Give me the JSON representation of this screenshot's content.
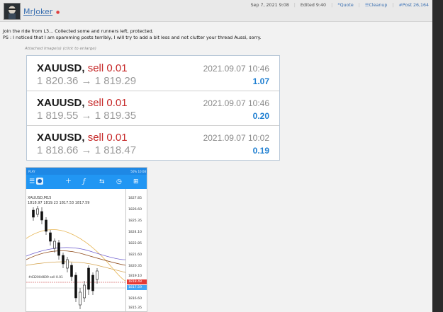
{
  "post": {
    "username": "MrJoker",
    "date": "Sep 7, 2021 9:08",
    "edited": "Edited 9:40",
    "quote_label": "Quote",
    "cleanup_label": "Cleanup",
    "post_number": "Post 26,164",
    "line1": "Join the ride from L3... Collected some and runners left, protected.",
    "line2": "PS : I noticed that I am spamming posts terribly, I will try to add a bit less and not clutter your thread Aussi, sorry.",
    "attach_caption": "Attached Image(s) (click to enlarge)"
  },
  "trades": [
    {
      "symbol": "XAUUSD,",
      "action": "sell 0.01",
      "prices": "1 820.36 → 1 819.29",
      "date": "2021.09.07 10:46",
      "profit": "1.07"
    },
    {
      "symbol": "XAUUSD,",
      "action": "sell 0.01",
      "prices": "1 819.55 → 1 819.35",
      "date": "2021.09.07 10:46",
      "profit": "0.20"
    },
    {
      "symbol": "XAUUSD,",
      "action": "sell 0.01",
      "prices": "1 818.66 → 1 818.47",
      "date": "2021.09.07 10:02",
      "profit": "0.19"
    }
  ],
  "phone": {
    "status_left": "PLAY",
    "status_right": "50% 10:08",
    "symbol_timeframe": "XAUUSD,M15",
    "ohlc": "1818.97 1819.23 1817.53 1817.59",
    "ticket": "#432004609 sell 0.01",
    "price_ticks": [
      "1827.85",
      "1826.60",
      "1825.35",
      "1824.10",
      "1822.85",
      "1821.60",
      "1820.35",
      "1819.10",
      "1817.85",
      "1816.60",
      "1815.35"
    ],
    "ask_tag": "1818.48",
    "bid_tag": "1817.59",
    "colors": {
      "accent": "#2196f3",
      "sell": "#c62828",
      "profit": "#1f7fd1"
    }
  }
}
